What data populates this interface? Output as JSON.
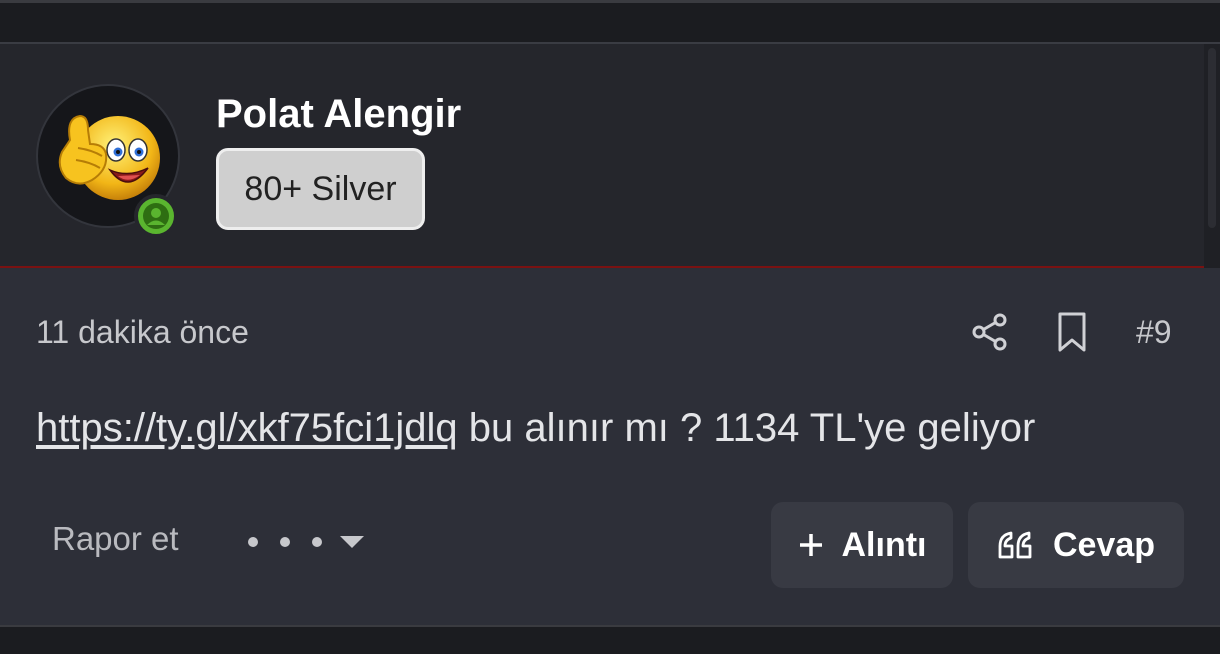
{
  "user": {
    "name": "Polat Alengir",
    "rank": "80+ Silver",
    "status_icon": "user-online-icon"
  },
  "post": {
    "time": "11 dakika önce",
    "number": "#9",
    "link": "https://ty.gl/xkf75fci1jdlq",
    "text": " bu alınır mı ? 1134 TL'ye geliyor"
  },
  "actions": {
    "report_label": "Rapor et",
    "quote_label": "Alıntı",
    "reply_label": "Cevap"
  },
  "icons": {
    "share": "share-icon",
    "bookmark": "bookmark-icon",
    "more": "more-options-icon",
    "plus": "plus-icon",
    "quote": "quote-icon"
  },
  "colors": {
    "header_divider": "#7a1212",
    "online": "#5ab52f",
    "rank_badge": "#cfcfcf"
  }
}
